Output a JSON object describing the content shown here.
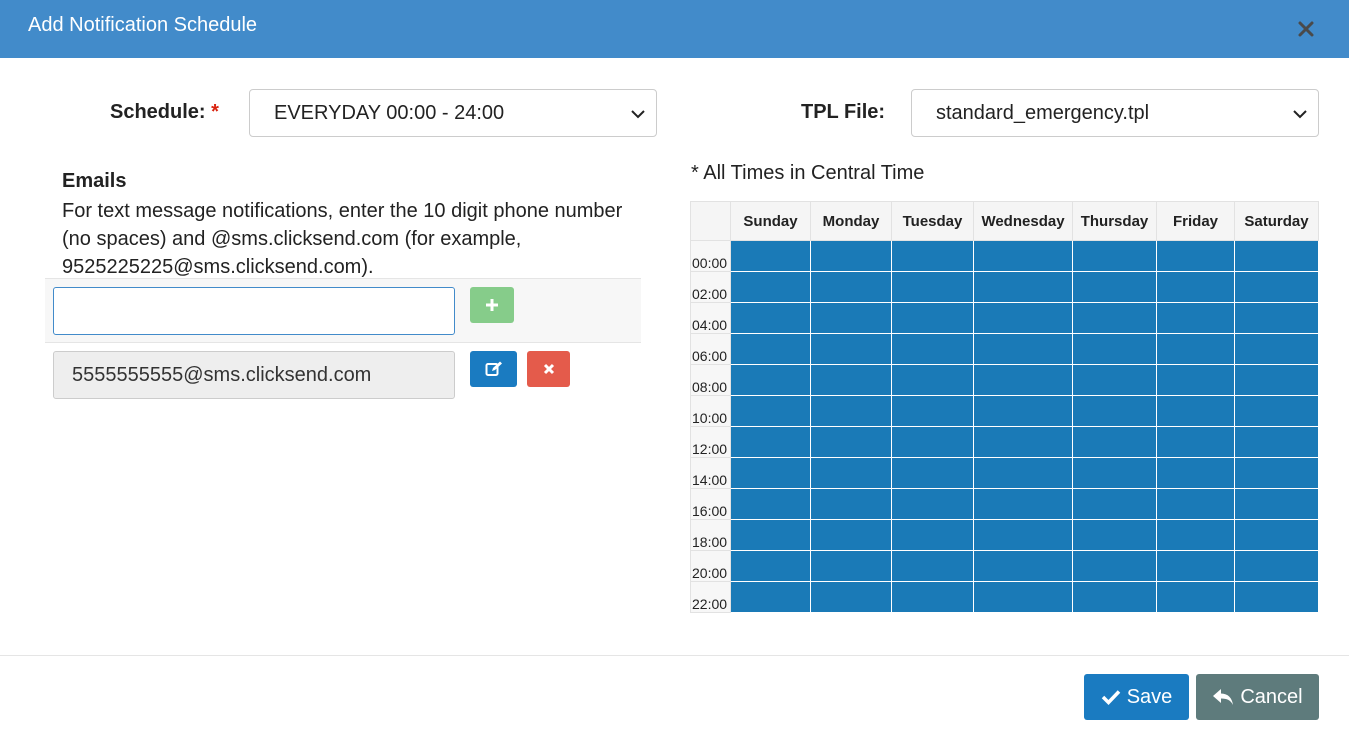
{
  "header": {
    "title": "Add Notification Schedule"
  },
  "form": {
    "schedule_label": "Schedule:",
    "required_mark": "*",
    "schedule_value": "EVERYDAY 00:00 - 24:00",
    "tpl_label": "TPL File:",
    "tpl_value": "standard_emergency.tpl"
  },
  "emails": {
    "heading": "Emails",
    "help": "For text message notifications, enter the 10 digit phone number (no spaces) and @sms.clicksend.com (for example, 9525225225@sms.clicksend.com).",
    "new_value": "",
    "items": [
      "5555555555@sms.clicksend.com"
    ]
  },
  "schedule_grid": {
    "note": "* All Times in Central Time",
    "days": [
      "Sunday",
      "Monday",
      "Tuesday",
      "Wednesday",
      "Thursday",
      "Friday",
      "Saturday"
    ],
    "times": [
      "00:00",
      "02:00",
      "04:00",
      "06:00",
      "08:00",
      "10:00",
      "12:00",
      "14:00",
      "16:00",
      "18:00",
      "20:00",
      "22:00"
    ],
    "active_color": "#1a7ab7"
  },
  "footer": {
    "save_label": "Save",
    "cancel_label": "Cancel"
  },
  "colors": {
    "header": "#428bca",
    "primary": "#1a7bc1",
    "success": "#86cc8a",
    "danger": "#e45b4b",
    "secondary": "#5e7b7c"
  },
  "icons": {
    "close": "close-icon",
    "add": "plus-icon",
    "edit": "edit-icon",
    "delete": "x-icon",
    "save": "check-icon",
    "cancel": "reply-icon",
    "dropdown": "chevron-down-icon"
  }
}
